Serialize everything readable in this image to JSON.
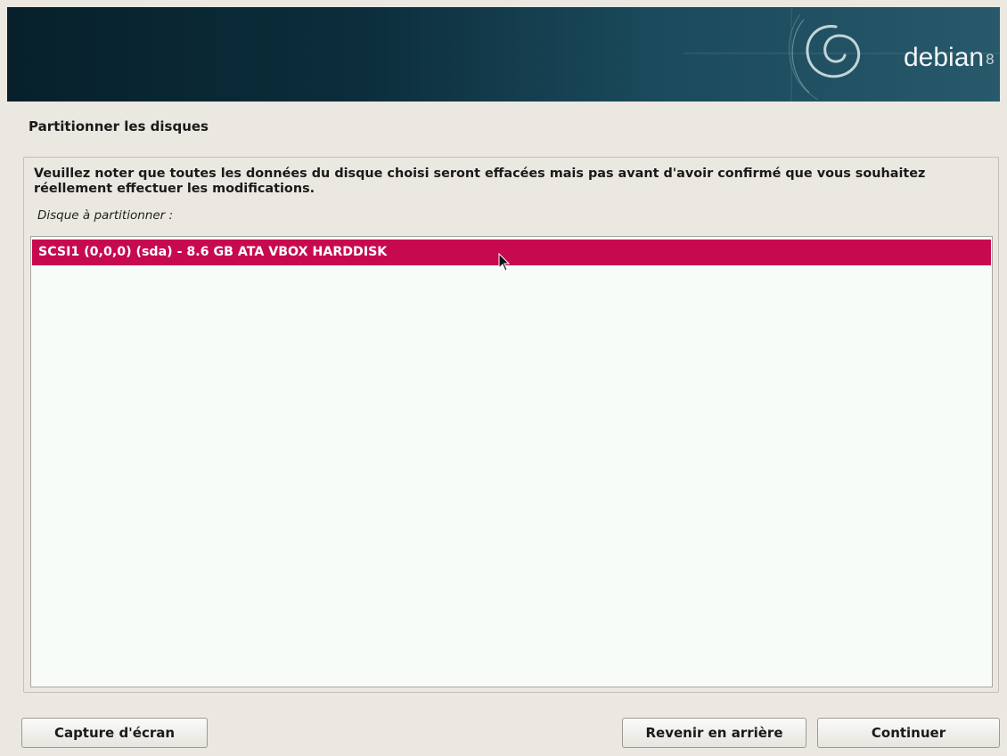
{
  "banner": {
    "logo_text": "debian",
    "logo_version": "8"
  },
  "page": {
    "title": "Partitionner les disques"
  },
  "content": {
    "description": "Veuillez noter que toutes les données du disque choisi seront effacées mais pas avant d'avoir confirmé que vous souhaitez réellement effectuer les modifications.",
    "list_label": "Disque à partitionner :",
    "disks": [
      {
        "label": "SCSI1 (0,0,0) (sda) - 8.6 GB ATA VBOX HARDDISK",
        "selected": true
      }
    ]
  },
  "buttons": {
    "screenshot": "Capture d'écran",
    "back": "Revenir en arrière",
    "continue": "Continuer"
  },
  "colors": {
    "selection": "#c70a4f",
    "banner_dark": "#07202b",
    "banner_light": "#27596b",
    "background": "#ebe8e2"
  },
  "icons": [
    "debian-swirl-icon",
    "mouse-pointer-icon"
  ]
}
